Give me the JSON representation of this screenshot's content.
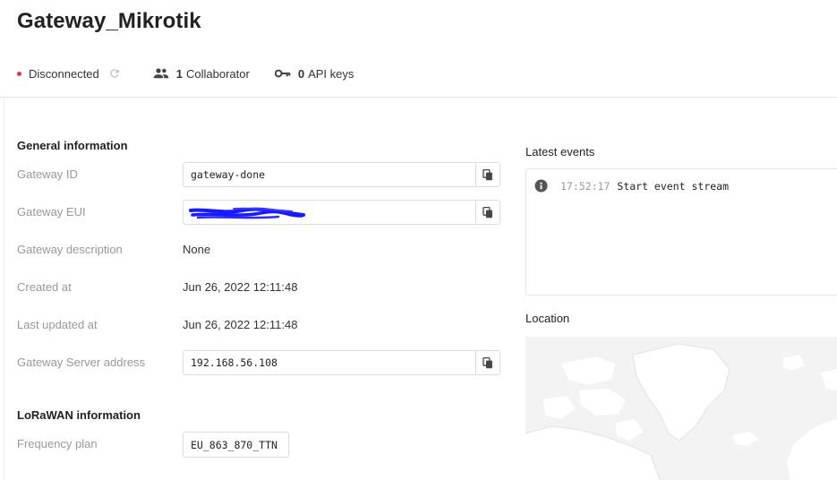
{
  "gateway": {
    "title": "Gateway_Mikrotik",
    "status": "Disconnected",
    "collaborators_count": "1",
    "collaborators_label": "Collaborator",
    "api_keys_count": "0",
    "api_keys_label": "API keys"
  },
  "general": {
    "heading": "General information",
    "gateway_id_label": "Gateway ID",
    "gateway_id_value": "gateway-done",
    "gateway_eui_label": "Gateway EUI",
    "gateway_eui_value": "",
    "description_label": "Gateway description",
    "description_value": "None",
    "created_label": "Created at",
    "created_value": "Jun 26, 2022 12:11:48",
    "updated_label": "Last updated at",
    "updated_value": "Jun 26, 2022 12:11:48",
    "server_label": "Gateway Server address",
    "server_value": "192.168.56.108"
  },
  "lorawan": {
    "heading": "LoRaWAN information",
    "frequency_label": "Frequency plan",
    "frequency_value": "EU_863_870_TTN"
  },
  "events": {
    "heading": "Latest events",
    "items": [
      {
        "time": "17:52:17",
        "message": "Start event stream"
      }
    ]
  },
  "location": {
    "heading": "Location"
  },
  "icons": {
    "status_dot": "red-dot-icon",
    "refresh": "refresh-icon",
    "collaborators": "people-icon",
    "api_keys": "key-icon",
    "copy": "copy-icon",
    "event": "info-icon"
  },
  "colors": {
    "status_disconnected": "#e53935",
    "muted_label": "#999999",
    "redaction": "#1a1aff"
  }
}
